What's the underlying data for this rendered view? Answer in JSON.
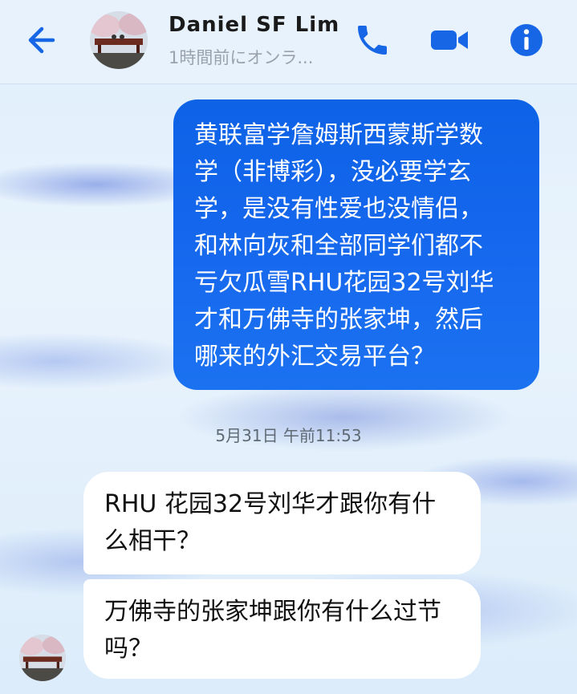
{
  "header": {
    "contact_name": "Daniel SF Lim",
    "status": "1時間前にオンラ...",
    "icons": {
      "back": "back-arrow-icon",
      "call": "phone-icon",
      "video": "video-camera-icon",
      "info": "info-icon"
    },
    "accent_color": "#1766e6"
  },
  "messages": [
    {
      "direction": "outgoing",
      "text": "黄联富学詹姆斯西蒙斯学数\n学（非博彩），没必要学玄\n学，是没有性爱也没情侣，\n和林向灰和全部同学们都不\n亏欠瓜雪RHU花园32号刘华\n才和万佛寺的张家坤，然后\n哪来的外汇交易平台？"
    },
    {
      "direction": "incoming",
      "text": "RHU 花园32号刘华才跟你有什\n么相干？"
    },
    {
      "direction": "incoming",
      "text": "万佛寺的张家坤跟你有什么过节\n吗？"
    }
  ],
  "timestamp": "5月31日 午前11:53",
  "colors": {
    "outgoing_bubble": "#1766e6",
    "incoming_bubble": "#ffffff",
    "background": "#e4effa"
  }
}
